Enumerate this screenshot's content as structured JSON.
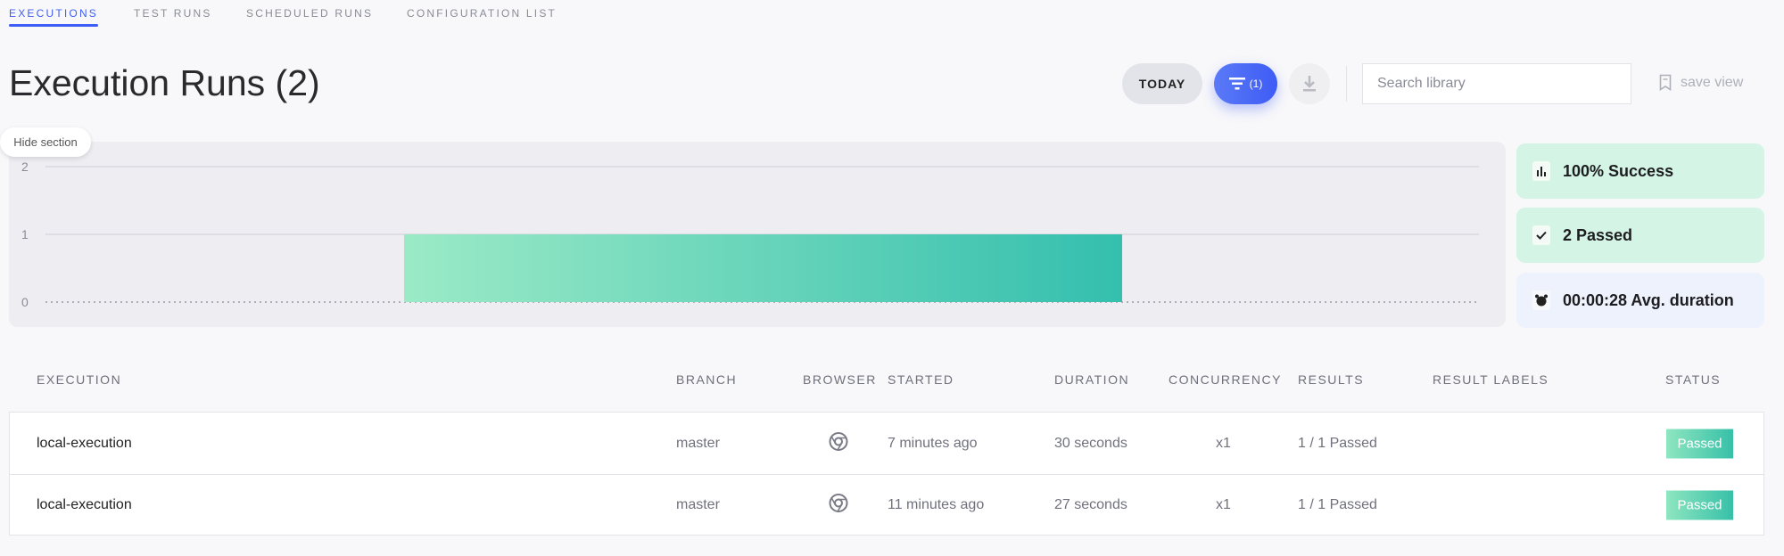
{
  "tabs": [
    {
      "label": "EXECUTIONS",
      "active": true
    },
    {
      "label": "TEST RUNS"
    },
    {
      "label": "SCHEDULED RUNS"
    },
    {
      "label": "CONFIGURATION LIST"
    }
  ],
  "page_title": "Execution Runs (2)",
  "toolbar": {
    "today_label": "TODAY",
    "filter_count": "(1)",
    "search_placeholder": "Search library",
    "save_view_label": "save view",
    "accent": "#3f5ef5"
  },
  "hide_section_label": "Hide section",
  "chart_data": {
    "type": "bar",
    "categories": [
      ""
    ],
    "values": [
      1
    ],
    "ylim": [
      0,
      2
    ],
    "yticks": [
      "0",
      "1",
      "2"
    ],
    "grid": true,
    "colors": [
      "#9beac6",
      "#34bfae"
    ]
  },
  "stats": [
    {
      "icon": "bar-chart-icon",
      "label": "100% Success",
      "bg": "#d4f4e6"
    },
    {
      "icon": "check-icon",
      "label": "2 Passed",
      "bg": "#d4f4e6"
    },
    {
      "icon": "alarm-clock-icon",
      "label": "00:00:28 Avg. duration",
      "bg": "#eef2fd"
    }
  ],
  "table": {
    "headers": [
      "EXECUTION",
      "BRANCH",
      "BROWSER",
      "STARTED",
      "DURATION",
      "CONCURRENCY",
      "RESULTS",
      "RESULT LABELS",
      "STATUS"
    ],
    "rows": [
      {
        "execution": "local-execution",
        "branch": "master",
        "browser": "chrome-icon",
        "started": "7 minutes ago",
        "duration": "30 seconds",
        "concurrency": "x1",
        "results": "1 / 1 Passed",
        "result_labels": "",
        "status": "Passed"
      },
      {
        "execution": "local-execution",
        "branch": "master",
        "browser": "chrome-icon",
        "started": "11 minutes ago",
        "duration": "27 seconds",
        "concurrency": "x1",
        "results": "1 / 1 Passed",
        "result_labels": "",
        "status": "Passed"
      }
    ]
  }
}
